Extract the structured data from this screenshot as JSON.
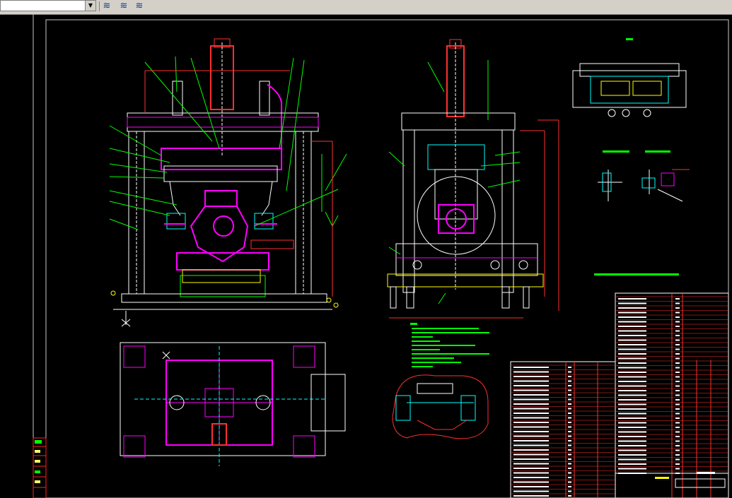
{
  "toolbar": {
    "layer_dropdown_value": "",
    "buttons": [
      "layer-properties-icon",
      "layer-previous-icon",
      "make-object-layer-current-icon"
    ]
  },
  "drawing": {
    "background": "#000000",
    "colors": {
      "frame": "#ffffff",
      "cyan": "#00ffff",
      "magenta": "#ff00ff",
      "green": "#00ff00",
      "yellow": "#ffff00",
      "red": "#ff0000"
    },
    "views": [
      "front-view",
      "side-view",
      "plan-view",
      "detail-top-right",
      "detail-sections",
      "detail-bottom-center"
    ],
    "title_block": {
      "drawing_no": "",
      "name": ""
    }
  }
}
